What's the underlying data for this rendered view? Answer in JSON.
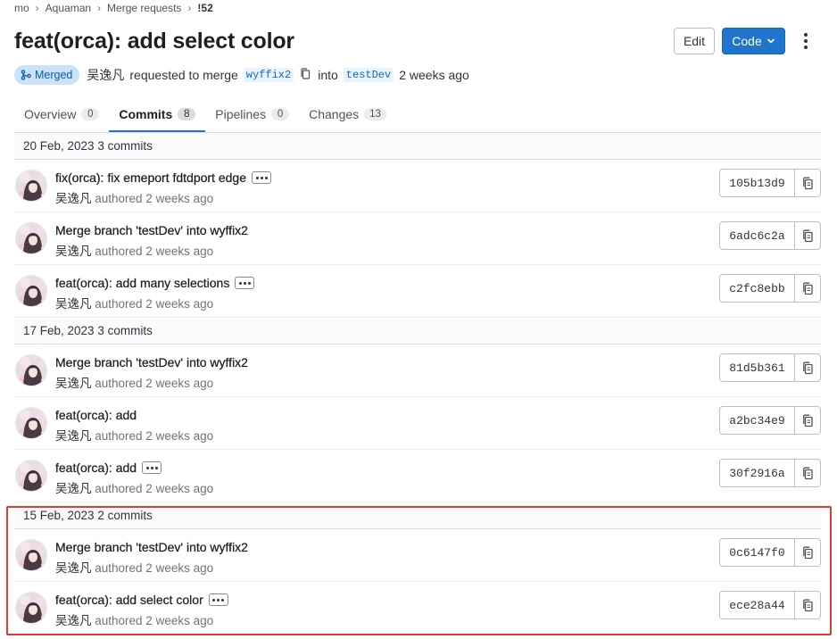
{
  "breadcrumb": [
    {
      "label": "mo"
    },
    {
      "label": "Aquaman"
    },
    {
      "label": "Merge requests"
    },
    {
      "label": "!52"
    }
  ],
  "breadcrumb_separator": "›",
  "title": "feat(orca): add select color",
  "actions": {
    "edit_label": "Edit",
    "code_label": "Code"
  },
  "meta": {
    "status_label": "Merged",
    "author": "吴逸凡",
    "requested_text": "requested to merge",
    "source_branch": "wyffix2",
    "into_text": "into",
    "target_branch": "testDev",
    "time": "2 weeks ago"
  },
  "tabs": [
    {
      "label": "Overview",
      "count": "0"
    },
    {
      "label": "Commits",
      "count": "8"
    },
    {
      "label": "Pipelines",
      "count": "0"
    },
    {
      "label": "Changes",
      "count": "13"
    }
  ],
  "commit_meta": {
    "author": "吴逸凡",
    "authored_text": "authored 2 weeks ago"
  },
  "groups": [
    {
      "date": "20 Feb, 2023 3 commits",
      "commits": [
        {
          "title": "fix(orca): fix emeport fdtdport edge",
          "sha": "105b13d9",
          "has_more": true
        },
        {
          "title": "Merge branch 'testDev' into wyffix2",
          "sha": "6adc6c2a",
          "has_more": false
        },
        {
          "title": "feat(orca): add many selections",
          "sha": "c2fc8ebb",
          "has_more": true
        }
      ]
    },
    {
      "date": "17 Feb, 2023 3 commits",
      "commits": [
        {
          "title": "Merge branch 'testDev' into wyffix2",
          "sha": "81d5b361",
          "has_more": false
        },
        {
          "title": "feat(orca): add",
          "sha": "a2bc34e9",
          "has_more": false
        },
        {
          "title": "feat(orca): add",
          "sha": "30f2916a",
          "has_more": true
        }
      ]
    },
    {
      "date": "15 Feb, 2023 2 commits",
      "commits": [
        {
          "title": "Merge branch 'testDev' into wyffix2",
          "sha": "0c6147f0",
          "has_more": false
        },
        {
          "title": "feat(orca): add select color",
          "sha": "ece28a44",
          "has_more": true
        }
      ]
    }
  ],
  "colors": {
    "accent": "#1f75cb",
    "merged_badge_bg": "#cbe2f9",
    "highlight": "#dd3b34"
  }
}
